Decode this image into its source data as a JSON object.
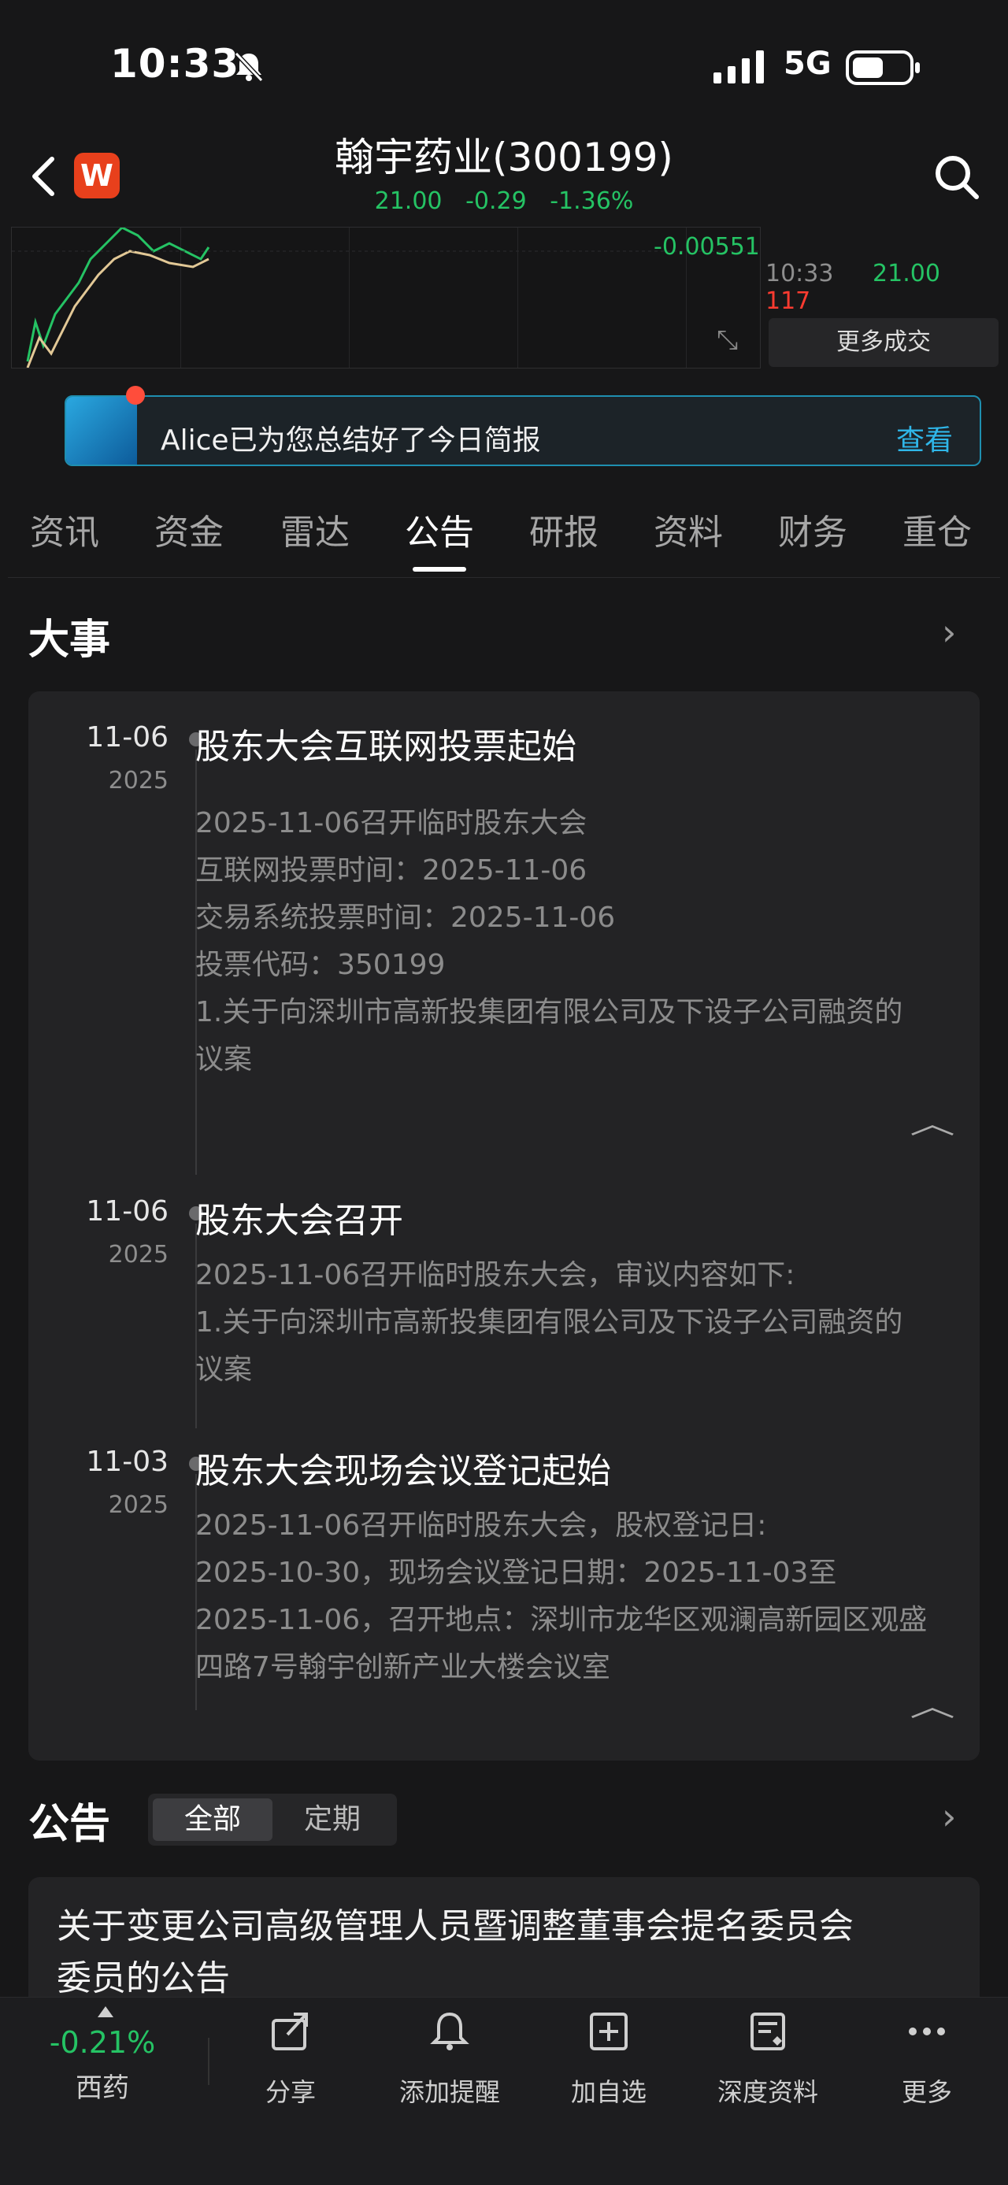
{
  "status_bar": {
    "time": "10:33",
    "network": "5G"
  },
  "header": {
    "title": "翰宇药业(300199)",
    "price": "21.00",
    "change": "-0.29",
    "change_pct": "-1.36%",
    "logo_text": "W"
  },
  "chart": {
    "axis_value": "-0.00551",
    "trade_time": "10:33",
    "trade_price": "21.00",
    "trade_volume": "117",
    "more_deals_label": "更多成交"
  },
  "banner": {
    "text": "Alice已为您总结好了今日简报",
    "action": "查看"
  },
  "tabs": [
    "资讯",
    "资金",
    "雷达",
    "公告",
    "研报",
    "资料",
    "财务",
    "重仓"
  ],
  "active_tab": "公告",
  "events": {
    "title": "大事",
    "items": [
      {
        "date": "11-06",
        "year": "2025",
        "title": "股东大会互联网投票起始",
        "lines": [
          "2025-11-06召开临时股东大会",
          "互联网投票时间：2025-11-06",
          "交易系统投票时间：2025-11-06",
          "投票代码：350199",
          "1.关于向深圳市高新投集团有限公司及下设子公司融资的",
          "议案"
        ]
      },
      {
        "date": "11-06",
        "year": "2025",
        "title": "股东大会召开",
        "lines": [
          "2025-11-06召开临时股东大会，审议内容如下:",
          "1.关于向深圳市高新投集团有限公司及下设子公司融资的",
          "议案"
        ]
      },
      {
        "date": "11-03",
        "year": "2025",
        "title": "股东大会现场会议登记起始",
        "lines": [
          "2025-11-06召开临时股东大会，股权登记日:",
          "2025-10-30，现场会议登记日期：2025-11-03至",
          "2025-11-06，召开地点：深圳市龙华区观澜高新园区观盛",
          "四路7号翰宇创新产业大楼会议室"
        ]
      }
    ]
  },
  "announcements": {
    "title": "公告",
    "filters": [
      "全部",
      "定期"
    ],
    "active_filter": "全部",
    "first_title_lines": [
      "关于变更公司高级管理人员暨调整董事会提名委员会",
      "委员的公告"
    ]
  },
  "bottom_bar": {
    "sector_change": "-0.21%",
    "sector_name": "西药",
    "items": [
      "分享",
      "添加提醒",
      "加自选",
      "深度资料",
      "更多"
    ]
  },
  "colors": {
    "down_green": "#25c364",
    "up_red": "#ff3b30",
    "accent_blue": "#2fb6e8"
  }
}
